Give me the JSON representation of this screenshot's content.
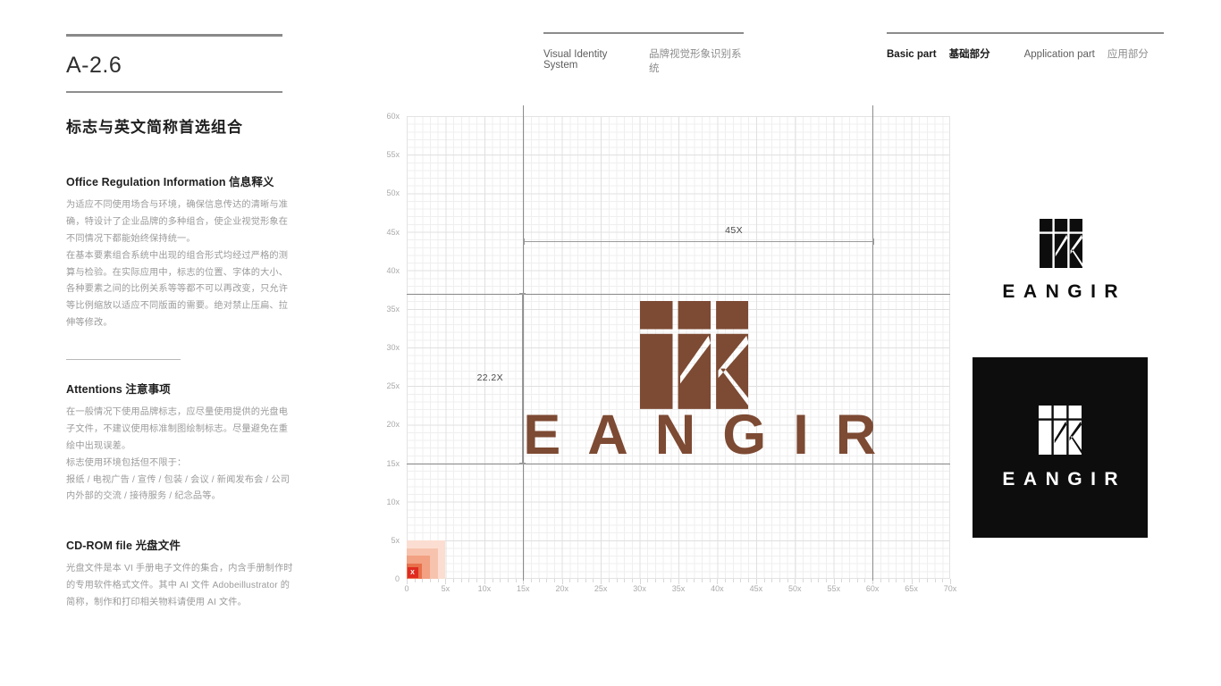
{
  "page": {
    "code": "A-2.6",
    "subtitle": "标志与英文简称首选组合"
  },
  "header": {
    "vis_en": "Visual Identity System",
    "vis_cn": "品牌视觉形象识别系统",
    "basic_en": "Basic part",
    "basic_cn": "基础部分",
    "app_en": "Application part",
    "app_cn": "应用部分"
  },
  "sections": {
    "office": {
      "title": "Office Regulation Information 信息释义",
      "p1": "为适应不同使用场合与环境，确保信息传达的清晰与准确，特设计了企业品牌的多种组合，使企业视觉形象在不同情况下都能始终保持统一。",
      "p2": "在基本要素组合系统中出现的组合形式均经过严格的测算与检验。在实际应用中，标志的位置、字体的大小、各种要素之间的比例关系等等都不可以再改变，只允许等比例缩放以适应不同版面的需要。绝对禁止压扁、拉伸等修改。"
    },
    "attentions": {
      "title": "Attentions 注意事项",
      "p1": "在一般情况下使用品牌标志，应尽量使用提供的光盘电子文件，不建议使用标准制图绘制标志。尽量避免在重绘中出现误差。",
      "p2": "标志使用环境包括但不限于：",
      "p3": "报纸 / 电视广告 / 宣传 / 包装 / 会议 / 新闻发布会 / 公司内外部的交流 / 接待服务 / 纪念品等。"
    },
    "cdrom": {
      "title": "CD-ROM file 光盘文件",
      "p1": "光盘文件是本 VI 手册电子文件的集合，内含手册制作时的专用软件格式文件。其中 AI 文件 Adobeillustrator 的简称，制作和打印相关物料请使用 AI 文件。"
    }
  },
  "chart_data": {
    "type": "scatter",
    "title": "",
    "xlabel": "",
    "ylabel": "",
    "xlim": [
      0,
      70
    ],
    "ylim": [
      0,
      60
    ],
    "grid": true,
    "minor_step": 1,
    "major_step": 5,
    "x_ticks": [
      "0",
      "5x",
      "10x",
      "15x",
      "20x",
      "25x",
      "30x",
      "35x",
      "40x",
      "45x",
      "50x",
      "55x",
      "60x",
      "65x",
      "70x"
    ],
    "x_tick_values": [
      0,
      5,
      10,
      15,
      20,
      25,
      30,
      35,
      40,
      45,
      50,
      55,
      60,
      65,
      70
    ],
    "y_ticks": [
      "0",
      "5x",
      "10x",
      "15x",
      "20x",
      "25x",
      "30x",
      "35x",
      "40x",
      "45x",
      "50x",
      "55x",
      "60x"
    ],
    "y_tick_values": [
      0,
      5,
      10,
      15,
      20,
      25,
      30,
      35,
      40,
      45,
      50,
      55,
      60
    ],
    "guides": {
      "horizontal": [
        15,
        37
      ],
      "vertical": [
        15,
        60
      ]
    },
    "annotations": [
      {
        "label": "45X",
        "axis": "horizontal",
        "from": 15,
        "to": 60,
        "at": 42.5
      },
      {
        "label": "22.2X",
        "axis": "vertical",
        "from": 15,
        "to": 37,
        "at": 12.5
      }
    ],
    "unit_marker": {
      "label": "X",
      "x": 0,
      "y": 0,
      "size": 5
    },
    "logo_bbox": {
      "x0": 30,
      "x1": 44,
      "y0": 22,
      "y1": 36
    },
    "wordmark_bbox": {
      "x0": 15,
      "x1": 60,
      "y0": 15,
      "y1": 22
    }
  },
  "logo": {
    "wordmark": "EANGIR",
    "brand_brown": "#7d4a33",
    "brand_black": "#0d0d0d",
    "brand_white": "#ffffff"
  },
  "samples": {
    "light_label": "EANGIR",
    "dark_label": "EANGIR"
  },
  "colors": {
    "accent_brown": "#7d4a33",
    "grid_minor": "#efefef",
    "grid_major": "#e0e0e0",
    "guide": "#8c8c8c",
    "marker_red": "#e02b20"
  }
}
